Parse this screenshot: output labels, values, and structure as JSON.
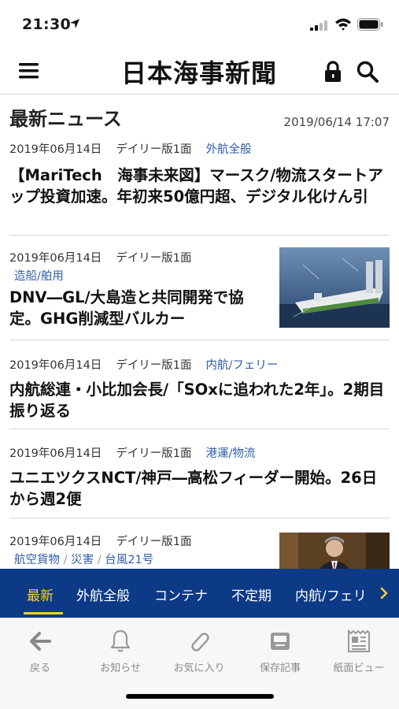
{
  "status_bar": {
    "time": "21:30"
  },
  "header": {
    "masthead": "日本海事新聞"
  },
  "section": {
    "title": "最新ニュース",
    "updated": "2019/06/14 17:07"
  },
  "articles": [
    {
      "date": "2019年06月14日",
      "edition": "デイリー版1面",
      "categories": [
        "外航全般"
      ],
      "headline": "【MariTech　海事未来図】マースク/物流スタートアップ投資加速。年初来50億円超、デジタル化けん引"
    },
    {
      "date": "2019年06月14日",
      "edition": "デイリー版1面",
      "categories": [
        "造船/舶用"
      ],
      "headline": "DNV―GL/大島造と共同開発で協定。GHG削減型バルカー",
      "thumbnail": "ship-illustration"
    },
    {
      "date": "2019年06月14日",
      "edition": "デイリー版1面",
      "categories": [
        "内航/フェリー"
      ],
      "headline": "内航総連・小比加会長/「SOxに追われた2年」。2期目振り返る"
    },
    {
      "date": "2019年06月14日",
      "edition": "デイリー版1面",
      "categories": [
        "港運/物流"
      ],
      "headline": "ユニエツクスNCT/神戸―高松フィーダー開始。26日から週2便"
    },
    {
      "date": "2019年06月14日",
      "edition": "デイリー版1面",
      "categories": [
        "航空貨物",
        "災害",
        "台風21号"
      ],
      "headline": "",
      "thumbnail": "person-photo"
    }
  ],
  "tabs": [
    {
      "label": "最新",
      "active": true
    },
    {
      "label": "外航全般",
      "active": false
    },
    {
      "label": "コンテナ",
      "active": false
    },
    {
      "label": "不定期",
      "active": false
    },
    {
      "label": "内航/フェリ",
      "active": false
    }
  ],
  "toolbar": [
    {
      "label": "戻る",
      "icon": "back-arrow-icon"
    },
    {
      "label": "お知らせ",
      "icon": "bell-icon"
    },
    {
      "label": "お気に入り",
      "icon": "paperclip-icon"
    },
    {
      "label": "保存記事",
      "icon": "saved-tray-icon"
    },
    {
      "label": "紙面ビュー",
      "icon": "newspaper-icon"
    }
  ],
  "colors": {
    "tab_bar": "#0c3a86",
    "active_tab": "#ffcc33",
    "category": "#2f5ea8"
  }
}
